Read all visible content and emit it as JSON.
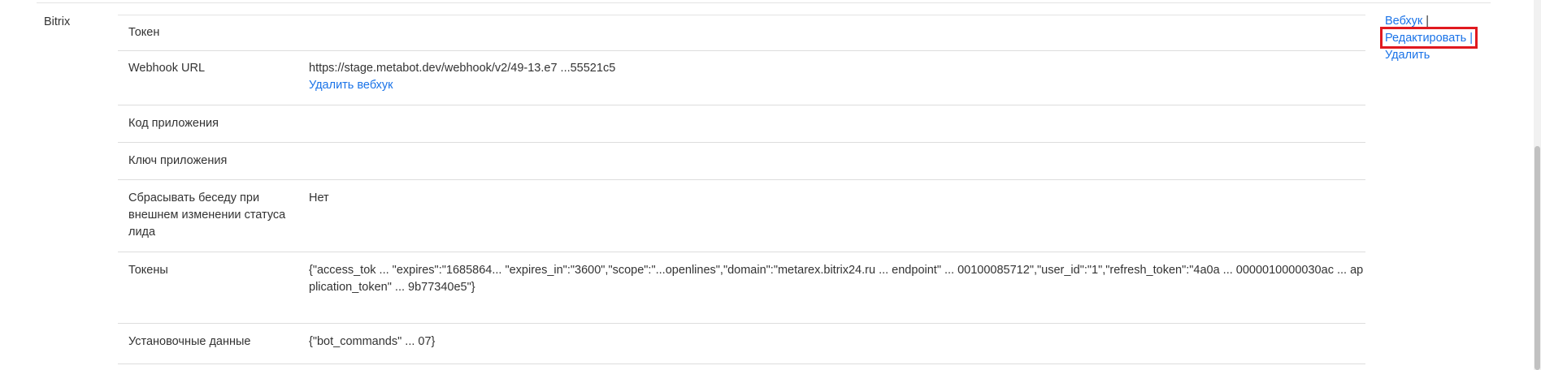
{
  "section": {
    "title": "Bitrix"
  },
  "rows": [
    {
      "label": "Токен",
      "value": ""
    },
    {
      "label": "Webhook URL",
      "value": "https://stage.metabot.dev/webhook/v2/49-13.e7 ...55521c5",
      "link": "Удалить вебхук"
    },
    {
      "label": "Код приложения",
      "value": ""
    },
    {
      "label": "Ключ приложения",
      "value": ""
    },
    {
      "label": "Сбрасывать беседу при внешнем изменении статуса лида",
      "value": "Нет"
    },
    {
      "label": "Токены",
      "value": "{\"access_tok ... \"expires\":\"1685864... \"expires_in\":\"3600\",\"scope\":\"...openlines\",\"domain\":\"metarex.bitrix24.ru ... endpoint\" ... 00100085712\",\"user_id\":\"1\",\"refresh_token\":\"4a0a ... 0000010000030ac ... application_token\" ... 9b77340e5\"}"
    },
    {
      "label": "Установочные данные",
      "value": "{\"bot_commands\" ... 07}"
    }
  ],
  "actions": {
    "webhook": "Вебхук",
    "edit": "Редактировать",
    "delete": "Удалить",
    "separator": "|"
  }
}
